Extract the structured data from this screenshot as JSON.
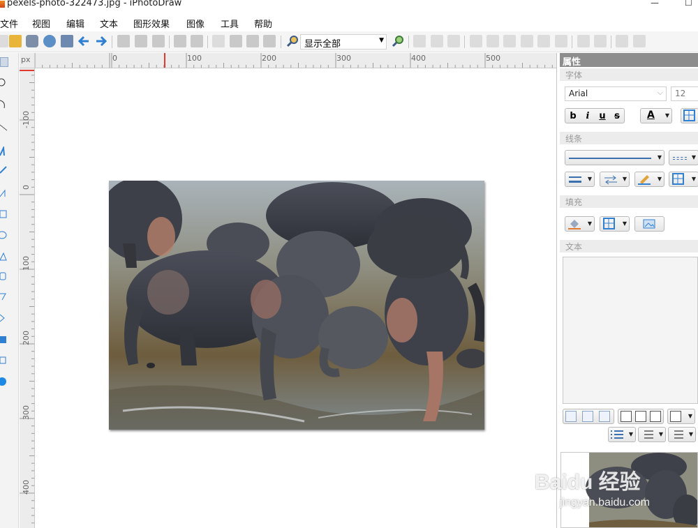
{
  "window": {
    "title": "pexels-photo-322473.jpg - iPhotoDraw",
    "minimize_glyph": "—",
    "maximize_glyph": "☐"
  },
  "menu": [
    "文件",
    "视图",
    "编辑",
    "文本",
    "图形效果",
    "图像",
    "工具",
    "帮助"
  ],
  "toolbar": {
    "zoom_value": "显示全部",
    "icons": [
      "new-icon",
      "open-icon",
      "web-icon",
      "save-as-icon",
      "undo-icon",
      "redo-icon",
      "cut-icon",
      "copy-icon",
      "paste-icon",
      "link-icon",
      "unlink-icon",
      "edit-icon",
      "brush-icon",
      "flip-icon",
      "perspective-icon",
      "zoom-out-icon",
      "zoom-in-icon",
      "align-icons",
      "group-icon",
      "ungroup-icon",
      "layer-icon"
    ]
  },
  "ruler": {
    "unit": "px",
    "h_labels": [
      "0",
      "100",
      "200",
      "300",
      "400",
      "500"
    ],
    "v_labels": [
      "-100",
      "0",
      "100",
      "200",
      "300",
      "400"
    ]
  },
  "panel": {
    "title": "属性",
    "font_section": "字体",
    "font_name": "Arial",
    "font_size": "12",
    "bold": "b",
    "italic": "i",
    "underline": "u",
    "strike": "s",
    "font_color_label": "A",
    "line_section": "线条",
    "fill_section": "填充",
    "text_section": "文本"
  },
  "watermark": {
    "brand": "Baidu 经验",
    "url": "jingyan.baidu.com"
  },
  "colors": {
    "accent_blue": "#2f7fd3",
    "panel_head": "#8d8d8d",
    "ruler_marker": "#e03a2f"
  }
}
